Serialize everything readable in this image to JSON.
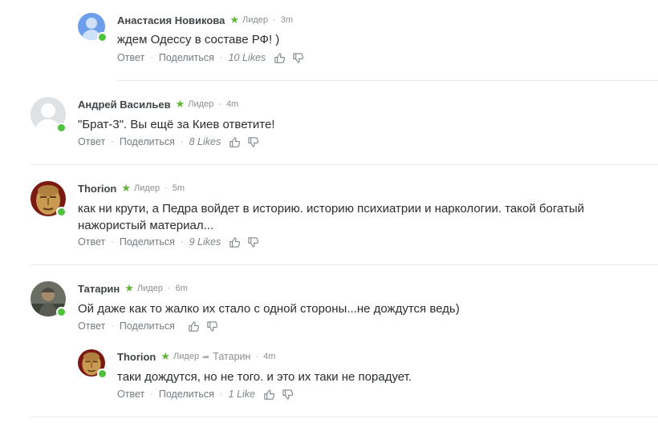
{
  "comments": [
    {
      "author": "Анастасия Новикова",
      "badge": "Лидер",
      "time": "3m",
      "text": "ждем Одессу в составе РФ! )",
      "reply": "Ответ",
      "share": "Поделиться",
      "likes": "10 Likes",
      "avatar": "default-blue"
    },
    {
      "author": "Андрей Васильев",
      "badge": "Лидер",
      "time": "4m",
      "text": "\"Брат-3\". Вы ещё за Киев ответите!",
      "reply": "Ответ",
      "share": "Поделиться",
      "likes": "8 Likes",
      "avatar": "default-grey"
    },
    {
      "author": "Thorion",
      "badge": "Лидер",
      "time": "5m",
      "text": "как ни крути, а Педра войдет в историю. историю психиатрии и наркологии. такой богатый нажористый материал...",
      "reply": "Ответ",
      "share": "Поделиться",
      "likes": "9 Likes",
      "avatar": "mask"
    },
    {
      "author": "Татарин",
      "badge": "Лидер",
      "time": "6m",
      "text": "Ой даже как то жалко их стало с одной стороны...не дождутся ведь)",
      "reply": "Ответ",
      "share": "Поделиться",
      "likes": "",
      "avatar": "warrior"
    },
    {
      "author": "Thorion",
      "badge": "Лидер",
      "reply_to": "Татарин",
      "time": "4m",
      "text": "таки дождутся, но не того. и это их таки не порадует.",
      "reply": "Ответ",
      "share": "Поделиться",
      "likes": "1 Like",
      "avatar": "mask"
    }
  ],
  "colors": {
    "online": "#4fc23d",
    "star": "#62b535",
    "separator": "#e7e9ee"
  },
  "icons": [
    "star-icon",
    "thumbs-up-icon",
    "thumbs-down-icon",
    "reply-arrow-icon",
    "online-indicator"
  ]
}
